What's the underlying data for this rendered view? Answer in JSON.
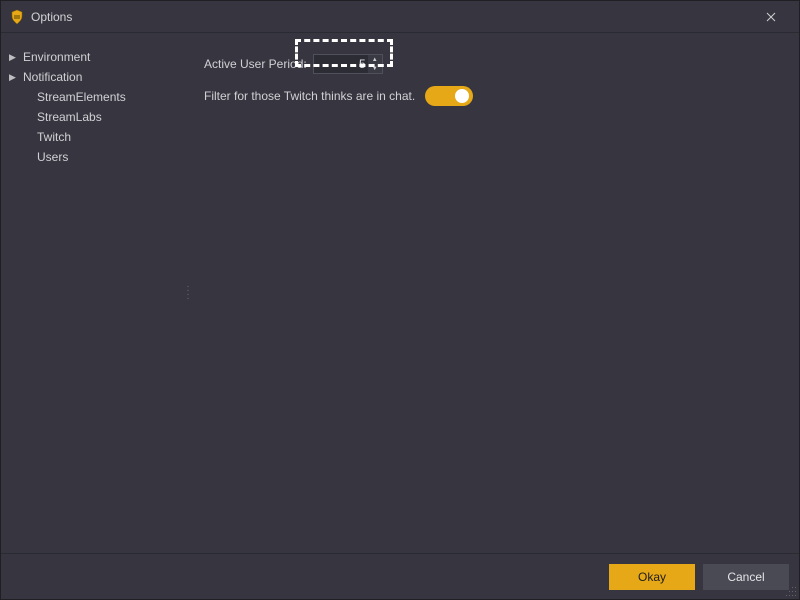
{
  "window": {
    "title": "Options"
  },
  "sidebar": {
    "items": [
      {
        "label": "Environment",
        "expandable": true
      },
      {
        "label": "Notification",
        "expandable": true
      },
      {
        "label": "StreamElements",
        "expandable": false
      },
      {
        "label": "StreamLabs",
        "expandable": false
      },
      {
        "label": "Twitch",
        "expandable": false
      },
      {
        "label": "Users",
        "expandable": false
      }
    ]
  },
  "settings": {
    "active_user_period": {
      "label": "Active User Period:",
      "value": "5"
    },
    "filter_chat": {
      "label": "Filter for those Twitch thinks are in chat.",
      "enabled": true
    }
  },
  "footer": {
    "okay": "Okay",
    "cancel": "Cancel"
  },
  "colors": {
    "accent": "#e6a817"
  }
}
